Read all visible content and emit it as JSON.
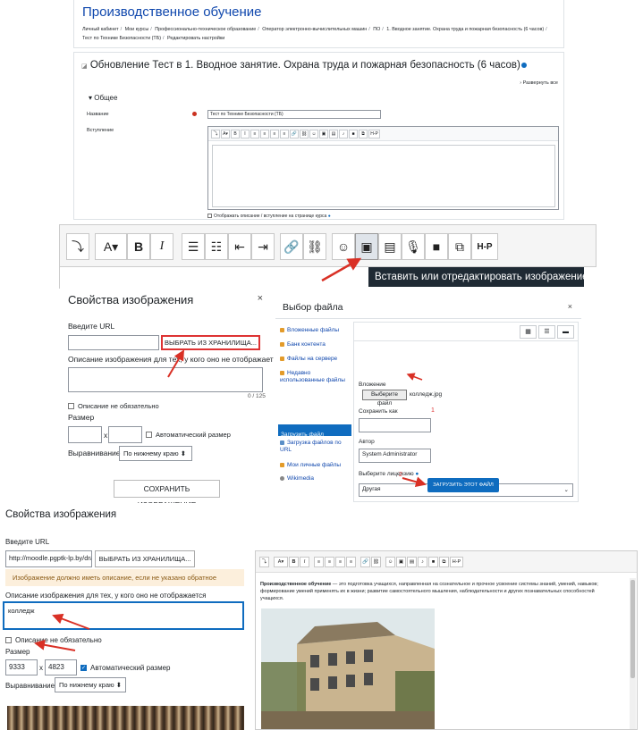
{
  "panel1": {
    "page_title": "Производственное обучение",
    "breadcrumbs": [
      "Личный кабинет",
      "Мои курсы",
      "Профессионально-техническое образование",
      "Оператор электронно-вычислительных машин",
      "ПО",
      "1. Вводное занятие. Охрана труда и пожарная безопасность (6 часов)",
      "Тест по Технике Безопасности (ТБ)",
      "Редактировать настройки"
    ],
    "edit_title": "Обновление Тест в 1. Вводное занятие. Охрана труда и пожарная безопасность (6 часов)",
    "expand_all": "Развернуть все",
    "section": "Общее",
    "name_label": "Название",
    "name_value": "Тест по Технике Безопасности (ТБ)",
    "intro_label": "Вступление",
    "show_desc": "Отображать описание / вступление на странице курса",
    "toolbar": [
      "⤵",
      "A▾",
      "B",
      "I",
      "≡",
      "≡",
      "≡",
      "≡",
      "🔗",
      "⛓",
      "☺",
      "▣",
      "▤",
      "♪",
      "■",
      "⧉",
      "H-P"
    ]
  },
  "panel2": {
    "buttons": {
      "g1": [
        "⤵"
      ],
      "g2": [
        "A▾",
        "B",
        "I"
      ],
      "g3": [
        "☰",
        "☷",
        "⇤",
        "⇥"
      ],
      "g4": [
        "🔗",
        "⛓"
      ],
      "g5": [
        "☺",
        "▣",
        "▤",
        "🎙",
        "■",
        "⧉",
        "H-P"
      ]
    },
    "tooltip": "Вставить или отредактировать изображение"
  },
  "panel3": {
    "title": "Свойства изображения",
    "close": "×",
    "url_label": "Введите URL",
    "browse": "ВЫБРАТЬ ИЗ ХРАНИЛИЩА...",
    "desc_label": "Описание изображения для тех, у кого оно не отображается",
    "counter": "0 / 125",
    "decorative": "Описание не обязательно",
    "size_label": "Размер",
    "size_x": "x",
    "auto_size": "Автоматический размер",
    "align_label": "Выравнивание",
    "align_value": "По нижнему краю ⬍",
    "save": "СОХРАНИТЬ ИЗОБРАЖЕНИЕ"
  },
  "panel4": {
    "title": "Выбор файла",
    "close": "×",
    "repos": [
      "Вложенные файлы",
      "Банк контента",
      "Файлы на сервере",
      "Недавно использованные файлы",
      "Загрузить файл",
      "Загрузка файлов по URL",
      "Мои личные файлы",
      "Wikimedia"
    ],
    "view_buttons": [
      "▦",
      "☰",
      "▬"
    ],
    "attachment_label": "Вложение",
    "choose_file": "Выберите файл",
    "file_name": "колледж.jpg",
    "save_as_label": "Сохранить как",
    "author_label": "Автор",
    "author_value": "System Administrator",
    "license_label": "Выберите лицензию",
    "license_value": "Другая",
    "upload": "ЗАГРУЗИТЬ ЭТОТ ФАЙЛ",
    "step1": "1",
    "step2": "2"
  },
  "panel5": {
    "title": "Свойства изображения",
    "url_label": "Введите URL",
    "url_value": "http://moodle.pgptk-lp.by/dra",
    "browse": "ВЫБРАТЬ ИЗ ХРАНИЛИЩА...",
    "warning": "Изображение должно иметь описание, если не указано обратное",
    "desc_label": "Описание изображения для тех, у кого оно не отображается",
    "desc_value": "колледж",
    "decorative": "Описание не обязательно",
    "size_label": "Размер",
    "width": "9333",
    "size_x": "x",
    "height": "4823",
    "auto_size": "Автоматический размер",
    "align_label": "Выравнивание",
    "align_value": "По нижнему краю ⬍"
  },
  "panel6": {
    "toolbar": [
      "⤵",
      "A▾",
      "B",
      "I",
      "≡",
      "≡",
      "≡",
      "≡",
      "🔗",
      "⛓",
      "☺",
      "▣",
      "▤",
      "♪",
      "■",
      "⧉",
      "H-P"
    ],
    "text_bold": "Производственное обучение",
    "text_rest": " — это подготовка учащихся, направленная на сознательное и прочное усвоение системы знаний, умений, навыков; формирование умений применять их в жизни; развитие самостоятельного мышления, наблюдательности и других познавательных способностей учащихся."
  },
  "colors": {
    "link": "#0f47ad",
    "primary": "#0f6cbf",
    "arrow": "#d93025",
    "tooltip_bg": "#1f2a34"
  }
}
